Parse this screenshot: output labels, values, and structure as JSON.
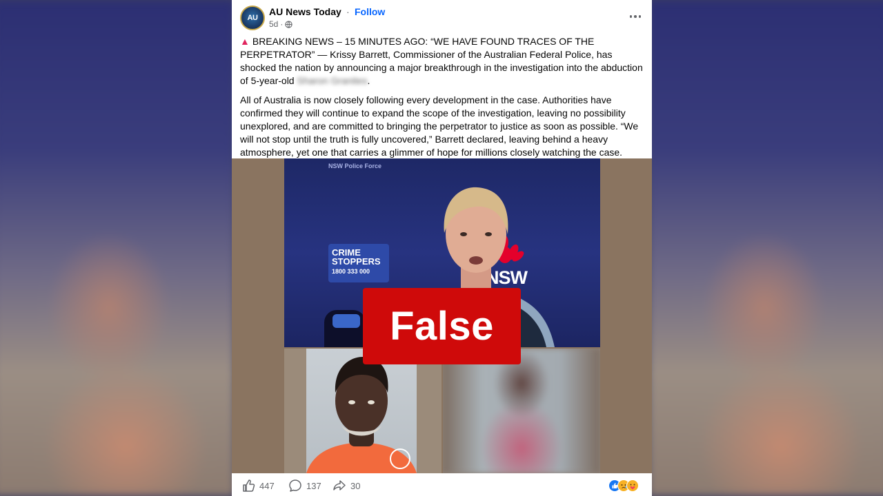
{
  "post": {
    "page_name": "AU News Today",
    "separator": "·",
    "follow_label": "Follow",
    "age": "5d",
    "dot": "·",
    "avatar_text": "AU",
    "paragraph1_lead": "BREAKING NEWS – 15 MINUTES AGO: “WE HAVE FOUND TRACES OF THE PERPETRATOR” — Krissy Barrett, Commissioner of the Australian Federal Police, has shocked the nation by announcing a major breakthrough in the investigation into the abduction of 5-year-old",
    "paragraph1_blurred": "Sharon Granites",
    "paragraph1_end": ".",
    "paragraph2": "All of Australia is now closely following every development in the case. Authorities have confirmed they will continue to expand the scope of the investigation, leaving no possibility unexplored, and are committed to bringing the perpetrator to justice as soon as possible. “We will not stop until the truth is fully uncovered,” Barrett declared, leaving behind a heavy atmosphere, yet one that carries a glimmer of hope for millions closely watching the case."
  },
  "media": {
    "banner_text": "NSW Police Force",
    "crime_stoppers_line1": "CRIME",
    "crime_stoppers_line2": "STOPPERS",
    "crime_stoppers_phone": "1800 333 000",
    "nsw_text": "NSW",
    "fact_check_label": "False",
    "fact_check_color": "#cf0a0a"
  },
  "actions": {
    "likes": "447",
    "comments": "137",
    "shares": "30"
  },
  "colors": {
    "follow": "#0866ff",
    "meta": "#65676b"
  }
}
